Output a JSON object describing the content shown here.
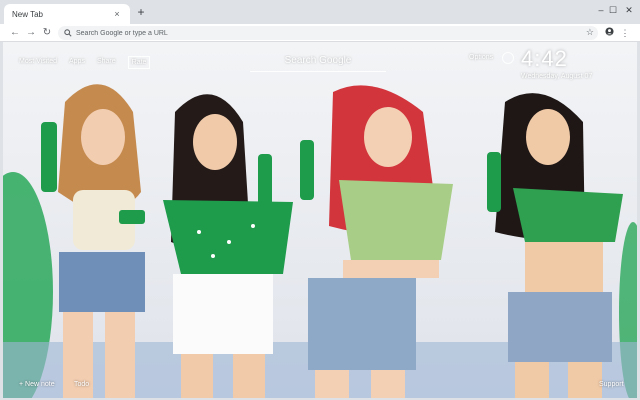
{
  "browser": {
    "tab_title": "New Tab",
    "tab_close": "×",
    "new_tab": "+",
    "window_controls": {
      "minimize": "–",
      "maximize": "☐",
      "close": "✕"
    },
    "omnibox_placeholder": "Search Google or type a URL",
    "icons": [
      "back-icon",
      "forward-icon",
      "reload-icon",
      "search-icon",
      "star-icon",
      "account-icon",
      "menu-icon"
    ]
  },
  "newtab": {
    "top_links": [
      {
        "label": "Most Visited"
      },
      {
        "label": "Apps"
      },
      {
        "label": "Share"
      },
      {
        "label": "Rate",
        "active": true
      }
    ],
    "search_placeholder": "Search Google",
    "options_label": "Options",
    "time": "4:42",
    "date": "Wednesday, August 07",
    "bottom": {
      "new_note": "+ New note",
      "todo": "Todo",
      "support": "Support"
    }
  },
  "colors": {
    "sprite_green": "#1e9b4b",
    "denim": "#6f8fb8",
    "sky": "#e9ecf0"
  }
}
